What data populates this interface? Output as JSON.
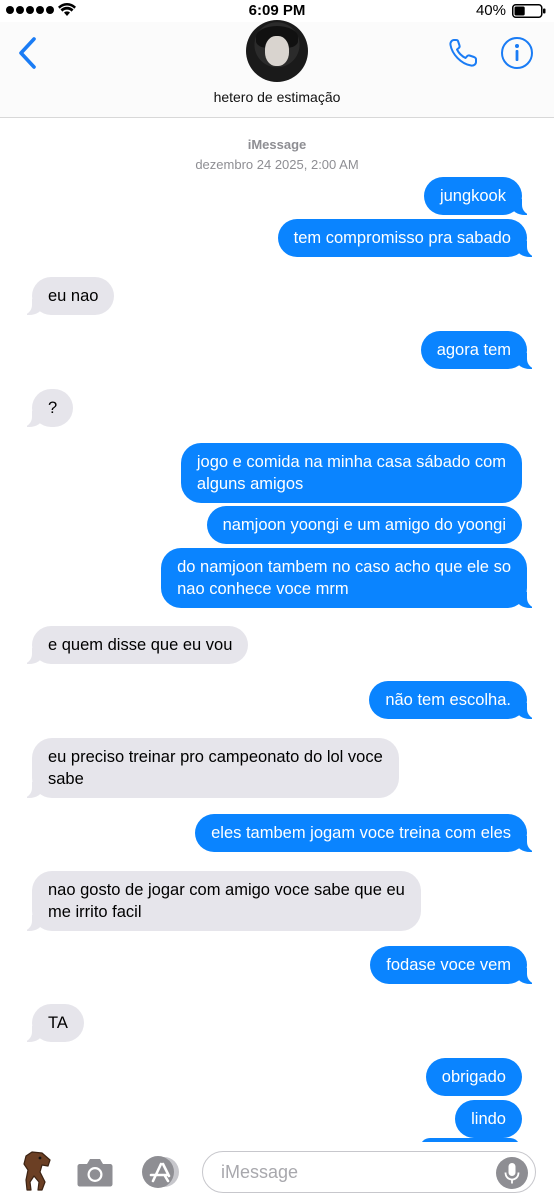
{
  "status_bar": {
    "time": "6:09 PM",
    "battery": "40%",
    "signal_icon": "signal-dots-icon",
    "wifi_icon": "wifi-icon",
    "battery_icon": "battery-icon",
    "battery_level": 0.4
  },
  "header": {
    "contact_name": "hetero de estimação",
    "back_icon": "chevron-left-icon",
    "call_icon": "phone-icon",
    "info_icon": "info-icon",
    "accent": "#1a7cf5"
  },
  "conversation": {
    "service": "iMessage",
    "date": "dezembro 24 2025, 2:00 AM"
  },
  "messages": [
    {
      "from": "me",
      "line1": "jungkook",
      "line2": ""
    },
    {
      "from": "me",
      "line1": "tem compromisso pra sabado",
      "line2": ""
    },
    {
      "from": "them",
      "line1": "eu nao",
      "line2": ""
    },
    {
      "from": "me",
      "line1": "agora tem",
      "line2": ""
    },
    {
      "from": "them",
      "line1": "?",
      "line2": ""
    },
    {
      "from": "me",
      "line1": "jogo e comida na minha casa sábado com",
      "line2": "alguns amigos"
    },
    {
      "from": "me",
      "line1": "namjoon yoongi e um amigo do yoongi",
      "line2": ""
    },
    {
      "from": "me",
      "line1": "do namjoon tambem no caso acho que ele so",
      "line2": "nao conhece voce mrm"
    },
    {
      "from": "them",
      "line1": "e quem disse que eu vou",
      "line2": ""
    },
    {
      "from": "me",
      "line1": "não tem escolha.",
      "line2": ""
    },
    {
      "from": "them",
      "line1": "eu preciso treinar pro campeonato do lol voce",
      "line2": "sabe"
    },
    {
      "from": "me",
      "line1": "eles tambem jogam voce treina com eles",
      "line2": ""
    },
    {
      "from": "them",
      "line1": "nao gosto de jogar com amigo voce sabe que eu",
      "line2": "me irrito facil"
    },
    {
      "from": "me",
      "line1": "fodase voce vem",
      "line2": ""
    },
    {
      "from": "them",
      "line1": "TA",
      "line2": ""
    },
    {
      "from": "me",
      "line1": "obrigado",
      "line2": ""
    },
    {
      "from": "me",
      "line1": "lindo",
      "line2": ""
    }
  ],
  "compose": {
    "placeholder": "iMessage",
    "sticker_icon": "horse-sticker-icon",
    "camera_icon": "camera-icon",
    "apps_icon": "app-store-icon",
    "mic_icon": "microphone-icon"
  },
  "colors": {
    "outgoing_bubble": "#0a84ff",
    "incoming_bubble": "#e6e5eb",
    "meta_text": "#8e8e93"
  }
}
